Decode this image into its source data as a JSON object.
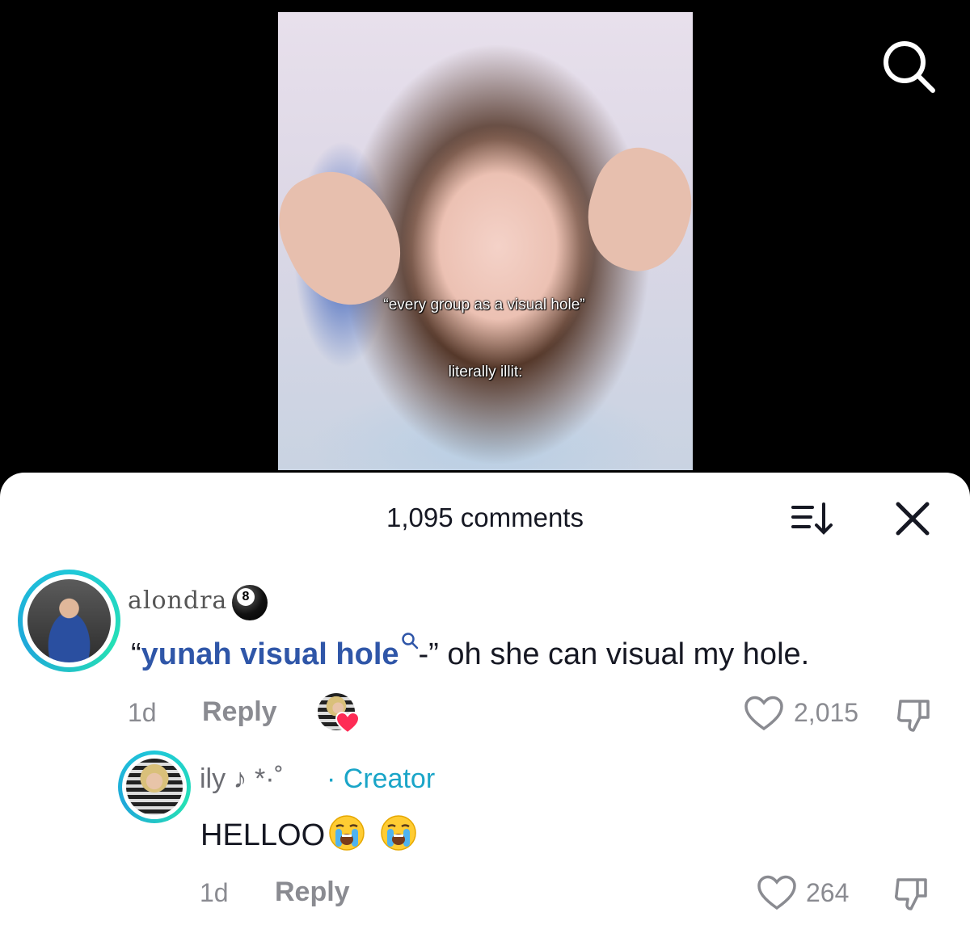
{
  "video": {
    "caption_line1": "“every group as a visual hole”",
    "caption_line2": "literally illit:"
  },
  "comments_panel": {
    "title": "1,095 comments"
  },
  "comments": [
    {
      "username": "alondra",
      "badge_emoji": "8",
      "text_open_quote": "“",
      "keyword": "yunah visual hole",
      "text_rest": "-” oh she can visual my hole.",
      "age": "1d",
      "reply_label": "Reply",
      "likes": "2,015"
    },
    {
      "username": "ily ♪ *·˚",
      "creator_label": "· Creator",
      "text": "HELLOO",
      "age": "1d",
      "reply_label": "Reply",
      "likes": "264"
    }
  ],
  "icons": {
    "search": "search-icon",
    "sort": "sort-icon",
    "close": "close-icon",
    "like": "heart-outline-icon",
    "dislike": "thumbs-down-icon",
    "creator_liked": "heart-filled-icon",
    "emoji": "loudly-crying-face-emoji"
  },
  "colors": {
    "keyword": "#2f56a8",
    "creator": "#1aa5c8",
    "creator_heart": "#fe2c55",
    "avatar_ring": "#1fc7d9"
  }
}
